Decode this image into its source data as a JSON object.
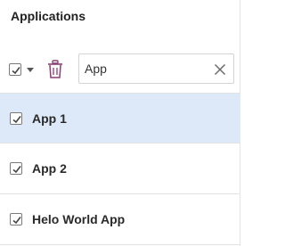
{
  "panel": {
    "title": "Applications"
  },
  "toolbar": {
    "select_all_checked": true,
    "delete_icon": "trash-icon",
    "search": {
      "value": "App",
      "placeholder": ""
    },
    "clear_icon": "close-icon"
  },
  "list": {
    "items": [
      {
        "label": "App 1",
        "checked": true,
        "selected": true
      },
      {
        "label": "App 2",
        "checked": true,
        "selected": false
      },
      {
        "label": "Helo World App",
        "checked": true,
        "selected": false
      }
    ]
  },
  "colors": {
    "selected_row": "#dde9f8",
    "trash_icon": "#8a3e74",
    "border": "#e2e2e2"
  }
}
